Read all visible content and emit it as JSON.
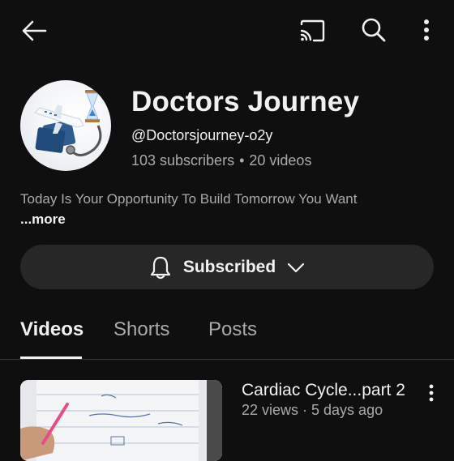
{
  "top_bar": {
    "back_icon": "arrow-left-icon",
    "cast_icon": "cast-icon",
    "search_icon": "search-icon",
    "more_icon": "more-vertical-icon"
  },
  "channel": {
    "name": "Doctors Journey",
    "handle": "@Doctorsjourney-o2y",
    "subscribers": "103 subscribers",
    "separator": "•",
    "videos_count": "20 videos",
    "description": "Today Is Your Opportunity To Build Tomorrow You Want",
    "more_label": "...more",
    "avatar_icon": "stethoscope-plane-avatar"
  },
  "subscribe_button": {
    "label": "Subscribed",
    "bell_icon": "bell-icon",
    "chevron_icon": "chevron-down-icon"
  },
  "tabs": [
    {
      "label": "Videos",
      "active": true
    },
    {
      "label": "Shorts",
      "active": false
    },
    {
      "label": "Posts",
      "active": false
    }
  ],
  "videos": [
    {
      "title": "Cardiac Cycle...part 2",
      "meta": "22 views · 5 days ago",
      "menu_icon": "more-vertical-icon"
    }
  ],
  "colors": {
    "background": "#0f0f0f",
    "button_bg": "#272727",
    "text_primary": "#f1f1f1",
    "text_secondary": "#aaaaaa"
  }
}
